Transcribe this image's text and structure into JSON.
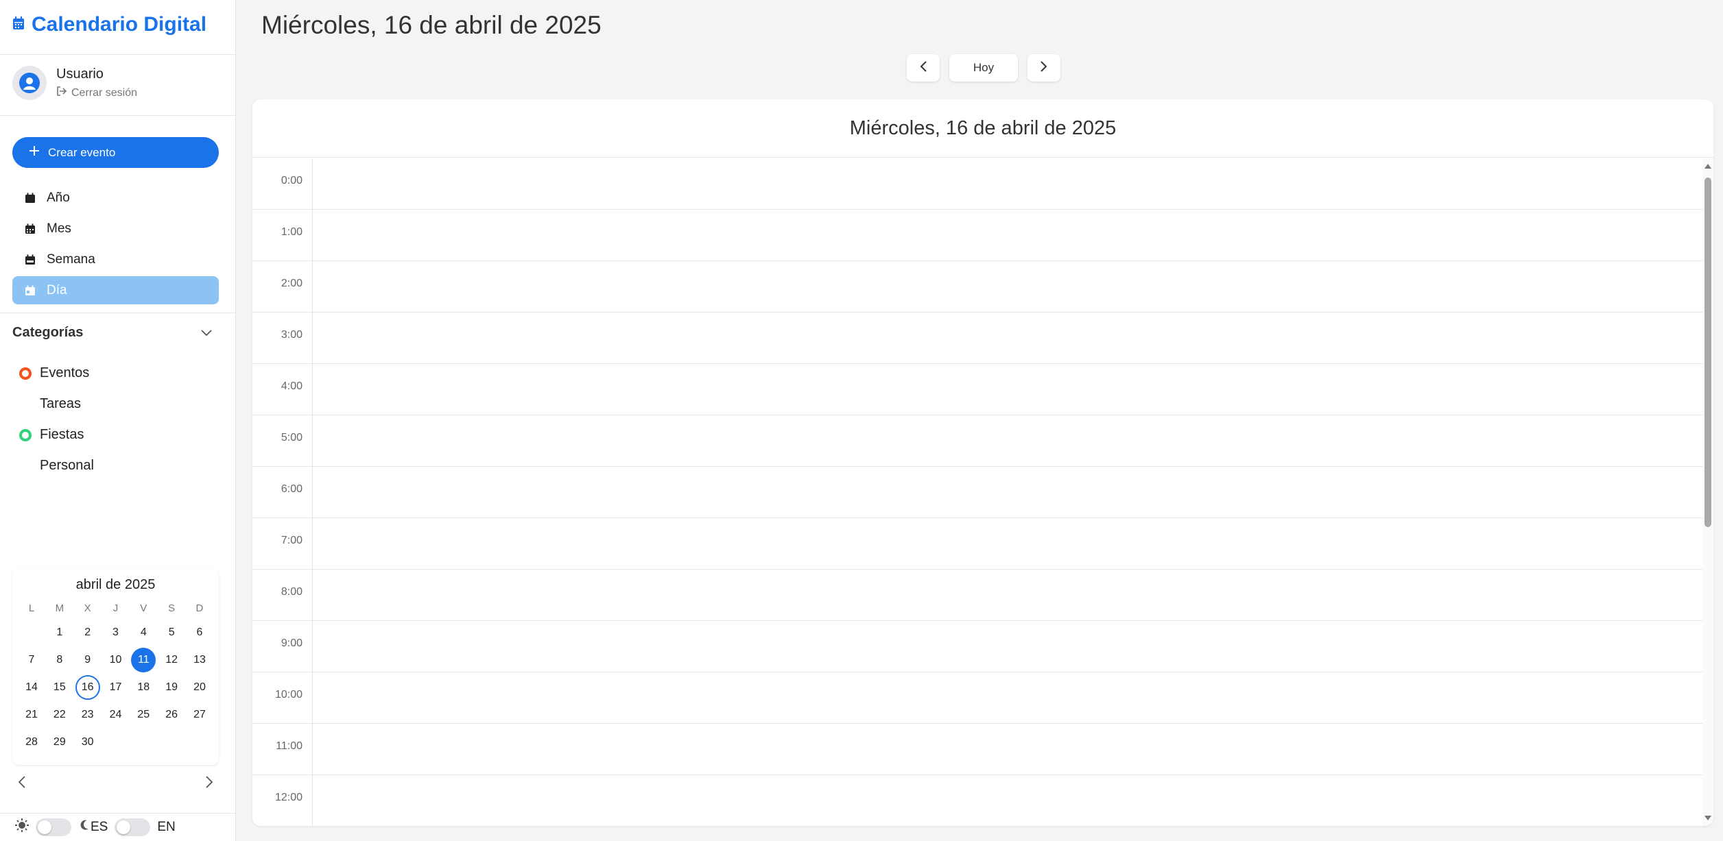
{
  "app": {
    "title": "Calendario Digital",
    "brand_color": "#1a73e8"
  },
  "user": {
    "name": "Usuario",
    "logout_label": "Cerrar sesión"
  },
  "create_button": {
    "label": "Crear evento"
  },
  "nav": {
    "items": [
      {
        "label": "Año",
        "icon": "calendar-icon",
        "active": false
      },
      {
        "label": "Mes",
        "icon": "calendar-icon",
        "active": false
      },
      {
        "label": "Semana",
        "icon": "calendar-week-icon",
        "active": false
      },
      {
        "label": "Día",
        "icon": "calendar-day-icon",
        "active": true
      }
    ]
  },
  "categories": {
    "title": "Categorías",
    "items": [
      {
        "label": "Eventos",
        "color": "#f4511e",
        "dot": true
      },
      {
        "label": "Tareas",
        "color": "",
        "dot": false
      },
      {
        "label": "Fiestas",
        "color": "#33d17a",
        "dot": true
      },
      {
        "label": "Personal",
        "color": "",
        "dot": false
      }
    ]
  },
  "mini_calendar": {
    "title": "abril de 2025",
    "weekdays": [
      "L",
      "M",
      "X",
      "J",
      "V",
      "S",
      "D"
    ],
    "leading_blank": 1,
    "days": [
      "1",
      "2",
      "3",
      "4",
      "5",
      "6",
      "7",
      "8",
      "9",
      "10",
      "11",
      "12",
      "13",
      "14",
      "15",
      "16",
      "17",
      "18",
      "19",
      "20",
      "21",
      "22",
      "23",
      "24",
      "25",
      "26",
      "27",
      "28",
      "29",
      "30"
    ],
    "selected_day": "11",
    "today_day": "16"
  },
  "footer": {
    "lang_left": "ES",
    "lang_right": "EN"
  },
  "main": {
    "title": "Miércoles, 16 de abril de 2025",
    "today_button": "Hoy",
    "panel_title": "Miércoles, 16 de abril de 2025",
    "hours": [
      "0:00",
      "1:00",
      "2:00",
      "3:00",
      "4:00",
      "5:00",
      "6:00",
      "7:00",
      "8:00",
      "9:00",
      "10:00",
      "11:00",
      "12:00"
    ]
  }
}
